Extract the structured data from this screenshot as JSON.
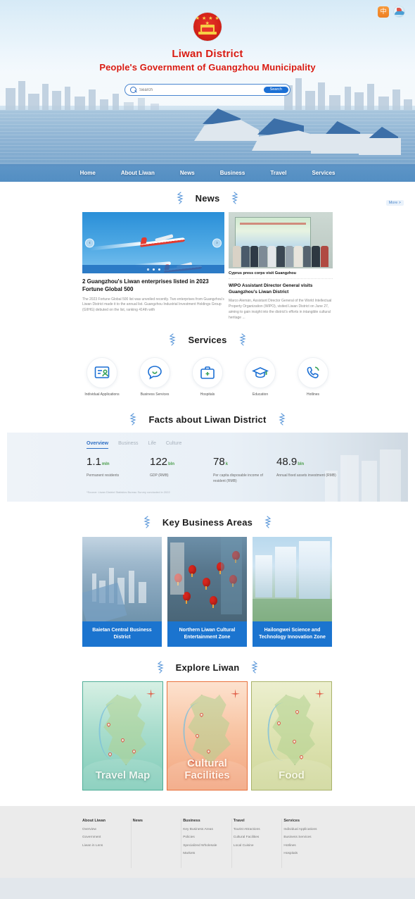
{
  "header": {
    "lang_toggle": "中",
    "badge_icon": "liwan-logo-badge",
    "title_cn": "Liwan District",
    "title_en": "People's Government of Guangzhou Municipality",
    "search": {
      "placeholder": "Search",
      "value": "",
      "button": "Search",
      "icon": "search-icon"
    },
    "nav": [
      {
        "label": "Home"
      },
      {
        "label": "About Liwan"
      },
      {
        "label": "News"
      },
      {
        "label": "Business"
      },
      {
        "label": "Travel"
      },
      {
        "label": "Services"
      }
    ]
  },
  "news": {
    "heading": "News",
    "more": "More >",
    "carousel": {
      "prev_icon": "chevron-left-icon",
      "next_icon": "chevron-right-icon",
      "dots": 3,
      "active_dot": 0,
      "title": "2 Guangzhou's Liwan enterprises listed in 2023 Fortune Global 500",
      "summary": "The 2023 Fortune Global 500 list was unveiled recently. Two enterprises from Guangzhou's Liwan District made it to the annual list. Guangzhou Industrial Investment Holdings Group (GIIHG) debuted on the list, ranking 414th with"
    },
    "side": {
      "row_title": "Cyprus press corps visit Guangzhou",
      "title": "WIPO Assistant Director General visits Guangzhou's Liwan District",
      "summary": "Marco Alemán, Assistant Director General of the World Intellectual Property Organization (WIPO), visited Liwan District on June 27, aiming to gain insight into the district's efforts in intangible cultural heritage ..."
    }
  },
  "services": {
    "heading": "Services",
    "items": [
      {
        "label": "Individual Applications",
        "icon": "person-document-icon"
      },
      {
        "label": "Business Services",
        "icon": "chat-smile-icon"
      },
      {
        "label": "Hospitals",
        "icon": "medical-kit-icon"
      },
      {
        "label": "Education",
        "icon": "graduation-cap-icon"
      },
      {
        "label": "Hotlines",
        "icon": "phone-icon"
      }
    ]
  },
  "facts": {
    "heading": "Facts about Liwan District",
    "tabs": [
      {
        "label": "Overview",
        "active": true
      },
      {
        "label": "Business",
        "active": false
      },
      {
        "label": "Life",
        "active": false
      },
      {
        "label": "Culture",
        "active": false
      }
    ],
    "stats": [
      {
        "value": "1.1",
        "unit": "mln",
        "label": "Permanent residents"
      },
      {
        "value": "122",
        "unit": "bln",
        "label": "GDP (RMB)"
      },
      {
        "value": "78",
        "unit": "k",
        "label": "Per capita disposable income of resident (RMB)"
      },
      {
        "value": "48.9",
        "unit": "bln",
        "label": "Annual fixed assets investment (RMB)"
      }
    ],
    "source": "*Source: Liwan District Statistics Bureau Survey conducted in 2022"
  },
  "business_areas": {
    "heading": "Key Business Areas",
    "cards": [
      {
        "caption": "Baietan Central Business District"
      },
      {
        "caption": "Northern Liwan Cultural Entertainment Zone"
      },
      {
        "caption": "Hailongwei Science and Technology Innovation Zone"
      }
    ]
  },
  "explore": {
    "heading": "Explore Liwan",
    "cards": [
      {
        "label": "Travel Map",
        "theme": "teal"
      },
      {
        "label": "Cultural Facilities",
        "theme": "orange"
      },
      {
        "label": "Food",
        "theme": "olive"
      }
    ]
  },
  "footer": {
    "columns": [
      {
        "title": "About Liwan",
        "links": [
          "Overview",
          "Government",
          "Liwan in Lens"
        ]
      },
      {
        "title": "News",
        "links": []
      },
      {
        "title": "Business",
        "links": [
          "Key Business Areas",
          "Policies",
          "Specialized Wholesale",
          "Markets"
        ]
      },
      {
        "title": "Travel",
        "links": [
          "Tourist Attractions",
          "Cultural Facilities",
          "Local Cuisine"
        ]
      },
      {
        "title": "Services",
        "links": [
          "Individual Applications",
          "Business Services",
          "Hotlines",
          "Hospitals"
        ]
      }
    ]
  },
  "colors": {
    "brand_red": "#d81a11",
    "brand_blue": "#1b74cf",
    "accent_orange": "#ee7f22",
    "stat_green": "#4a9d4a"
  }
}
